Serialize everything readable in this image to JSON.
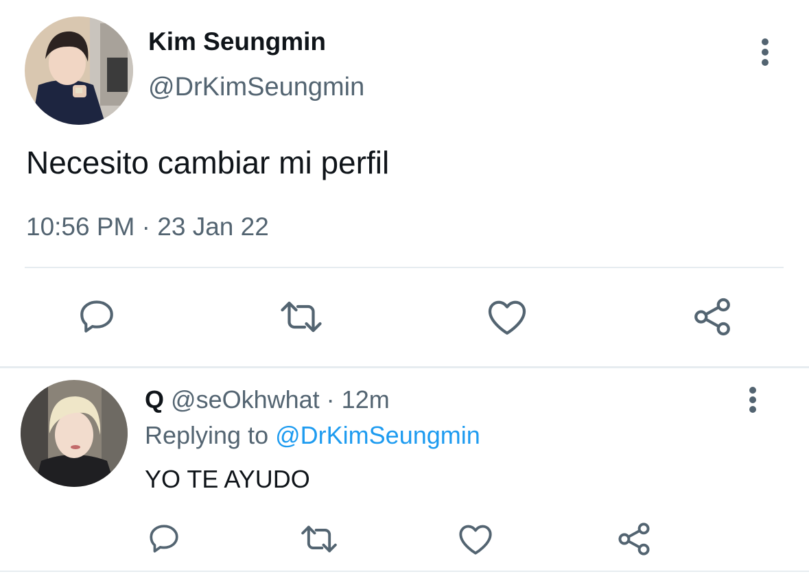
{
  "tweet": {
    "display_name": "Kim Seungmin",
    "handle": "@DrKimSeungmin",
    "text": "Necesito cambiar mi perfil",
    "time": "10:56 PM",
    "separator": " · ",
    "date": "23 Jan 22",
    "avatar_icon": "profile-photo",
    "more_icon": "vertical-dots-icon"
  },
  "reply": {
    "display_name": "Q",
    "handle": "@seOkhwhat",
    "separator": " · ",
    "age": "12m",
    "replying_label": "Replying to",
    "replying_to": "@DrKimSeungmin",
    "text": "YO TE AYUDO",
    "avatar_icon": "profile-photo",
    "more_icon": "vertical-dots-icon"
  },
  "actions": [
    "reply-icon",
    "retweet-icon",
    "like-icon",
    "share-icon"
  ],
  "colors": {
    "text": "#0f1419",
    "secondary": "#536471",
    "link": "#1d9bf0",
    "divider": "#e6ecf0"
  }
}
